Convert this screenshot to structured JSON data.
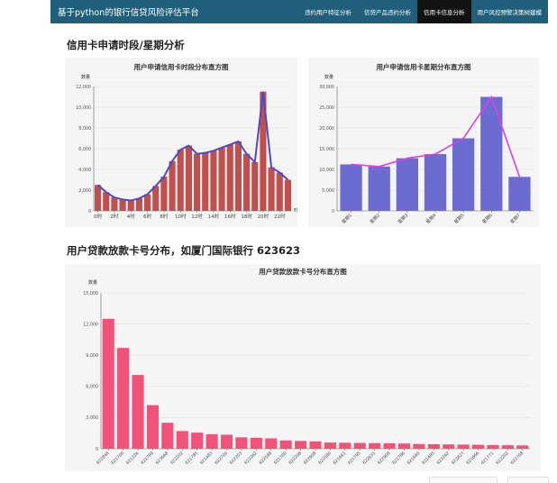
{
  "header": {
    "brand": "基于python的银行信贷风险评估平台",
    "nav": [
      {
        "label": "违约用户特征分析",
        "active": false
      },
      {
        "label": "信贷产品违约分析",
        "active": false
      },
      {
        "label": "信用卡信息分析",
        "active": true
      },
      {
        "label": "用户风控预警决策树建模",
        "active": false
      }
    ]
  },
  "section1": {
    "title": "信用卡申请时段/星期分析"
  },
  "section2": {
    "title": "用户贷款放款卡号分布，如厦门国际银行 623623"
  },
  "colors": {
    "bar_hour": "#c0504d",
    "bar_week": "#6b6bd0",
    "bar_card": "#f0527a",
    "line_hour": "#4b4bc8",
    "line_week": "#e040e0",
    "topbar": "#1f5f7a"
  },
  "chart_data": [
    {
      "type": "bar",
      "title": "用户申请信用卡时段分布直方图",
      "ylabel": "数量",
      "ylim": [
        0,
        12000
      ],
      "yticks": [
        "0",
        "2,000",
        "4,000",
        "6,000",
        "8,000",
        "10,000",
        "12,000"
      ],
      "categories": [
        "0时",
        "1时",
        "2时",
        "3时",
        "4时",
        "5时",
        "6时",
        "7时",
        "8时",
        "9时",
        "10时",
        "11时",
        "12时",
        "13时",
        "14时",
        "15时",
        "16时",
        "17时",
        "18时",
        "19时",
        "20时",
        "21时",
        "22时",
        "23时"
      ],
      "xtick_labels": [
        "0时",
        "2时",
        "4时",
        "6时",
        "8时",
        "10时",
        "12时",
        "14时",
        "16时",
        "18时",
        "20时",
        "22时"
      ],
      "x_end_label": "时",
      "values": [
        2500,
        1800,
        1300,
        1100,
        1000,
        1200,
        1600,
        2400,
        3300,
        4800,
        5900,
        6300,
        5500,
        5600,
        5800,
        6100,
        6400,
        6700,
        5500,
        4700,
        11500,
        4200,
        3700,
        3000
      ],
      "overlay_line": true
    },
    {
      "type": "bar",
      "title": "用户申请信用卡星期分布直方图",
      "ylabel": "数量",
      "ylim": [
        0,
        30000
      ],
      "yticks": [
        "0",
        "5,000",
        "10,000",
        "15,000",
        "20,000",
        "25,000",
        "30,000"
      ],
      "categories": [
        "星期1",
        "星期2",
        "星期3",
        "星期4",
        "星期5",
        "星期6",
        "星期7"
      ],
      "xtick_labels": [
        "星期1",
        "星期2",
        "星期3",
        "星期4",
        "星期5",
        "星期6",
        "星期7"
      ],
      "values": [
        11200,
        10700,
        12700,
        13700,
        17500,
        27500,
        8200
      ],
      "overlay_line": true
    },
    {
      "type": "bar",
      "title": "用户贷款放款卡号分布直方图",
      "ylabel": "数量",
      "ylim": [
        0,
        15000
      ],
      "yticks": [
        "0",
        "3,000",
        "6,000",
        "9,000",
        "12,000",
        "15,000"
      ],
      "categories": [
        "622848",
        "621700",
        "621226",
        "621799",
        "623668",
        "622202",
        "621785",
        "621483",
        "622700",
        "622203",
        "622262",
        "622588",
        "621700",
        "622208",
        "622908",
        "622580",
        "621661",
        "621795",
        "622631",
        "622908",
        "621786",
        "621660",
        "621485",
        "622262",
        "622827",
        "621666",
        "621771",
        "622202",
        "622708"
      ],
      "xtick_labels": [
        "622848",
        "621700",
        "621226",
        "621799",
        "623668",
        "622202",
        "621785",
        "621483",
        "622700",
        "622203",
        "622262",
        "622588",
        "621700",
        "622208",
        "622908",
        "622580",
        "621661",
        "621795",
        "622631",
        "622908",
        "621786",
        "621660",
        "621485",
        "622262",
        "622827",
        "621666",
        "621771",
        "622202",
        "622708"
      ],
      "values": [
        12500,
        9700,
        7100,
        4200,
        2500,
        1700,
        1550,
        1400,
        1350,
        1100,
        1050,
        1000,
        800,
        750,
        700,
        600,
        580,
        560,
        540,
        520,
        500,
        460,
        440,
        420,
        400,
        380,
        360,
        340,
        320
      ],
      "overlay_line": false
    }
  ]
}
